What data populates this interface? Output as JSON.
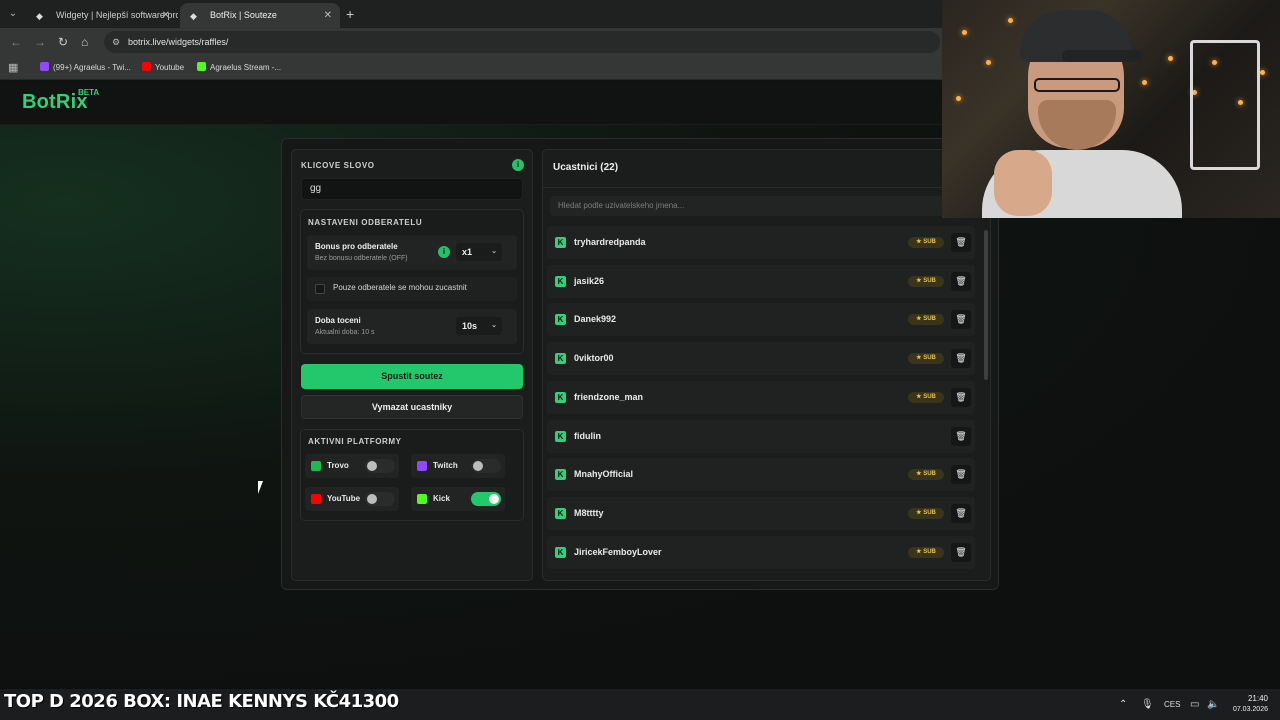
{
  "browser": {
    "tabs": [
      {
        "label": "Widgety | Nejlepší software pro",
        "icon": "botrix-favicon"
      },
      {
        "label": "BotRix | Souteze",
        "icon": "botrix-favicon"
      }
    ],
    "url": "botrix.live/widgets/raffles/",
    "bookmarks": [
      {
        "label": "(99+) Agraelus - Twi...",
        "icon": "twitch-icon",
        "color": "#9146ff"
      },
      {
        "label": "Youtube",
        "icon": "youtube-icon",
        "color": "#ff0000"
      },
      {
        "label": "Agraelus Stream -...",
        "icon": "kick-icon",
        "color": "#53fc18"
      }
    ]
  },
  "header": {
    "logo": "BotRix",
    "badge": "BETA"
  },
  "left": {
    "keyword_label": "KLICOVE SLOVO",
    "keyword_value": "gg",
    "subscribers_section": "NASTAVENI ODBERATELU",
    "bonus_title": "Bonus pro odberatele",
    "bonus_sub": "Bez bonusu odberatele (OFF)",
    "bonus_value": "x1",
    "only_subs_label": "Pouze odberatele se mohou zucastnit",
    "spin_title": "Doba toceni",
    "spin_sub": "Aktualni doba: 10 s",
    "spin_value": "10s",
    "start_button": "Spustit soutez",
    "clear_button": "Vymazat ucastniky",
    "platforms_label": "AKTIVNI PLATFORMY",
    "platforms": [
      {
        "name": "Trovo",
        "on": false,
        "color": "#1db954"
      },
      {
        "name": "Twitch",
        "on": false,
        "color": "#9146ff"
      },
      {
        "name": "YouTube",
        "on": false,
        "color": "#ff0000"
      },
      {
        "name": "Kick",
        "on": true,
        "color": "#53fc18"
      }
    ]
  },
  "right": {
    "title": "Ucastnici (22)",
    "search_placeholder": "Hledat podle uzivatelskeho jmena...",
    "sub_badge": "SUB",
    "users": [
      {
        "name": "tryhardredpanda",
        "sub": true
      },
      {
        "name": "jasik26",
        "sub": true
      },
      {
        "name": "Danek992",
        "sub": true
      },
      {
        "name": "0viktor00",
        "sub": true
      },
      {
        "name": "friendzone_man",
        "sub": true
      },
      {
        "name": "fidulin",
        "sub": false
      },
      {
        "name": "MnahyOfficial",
        "sub": true
      },
      {
        "name": "M8tttty",
        "sub": true
      },
      {
        "name": "JiricekFemboyLover",
        "sub": true
      }
    ]
  },
  "taskbar": {
    "ticker": "TOP D 2026 BOX: INAE  KENNYS  KČ41300",
    "lang": "CES",
    "time": "21:40",
    "date": "07.03.2026"
  },
  "colors": {
    "accent": "#24c86c",
    "sub_badge": "#e8c54a"
  }
}
